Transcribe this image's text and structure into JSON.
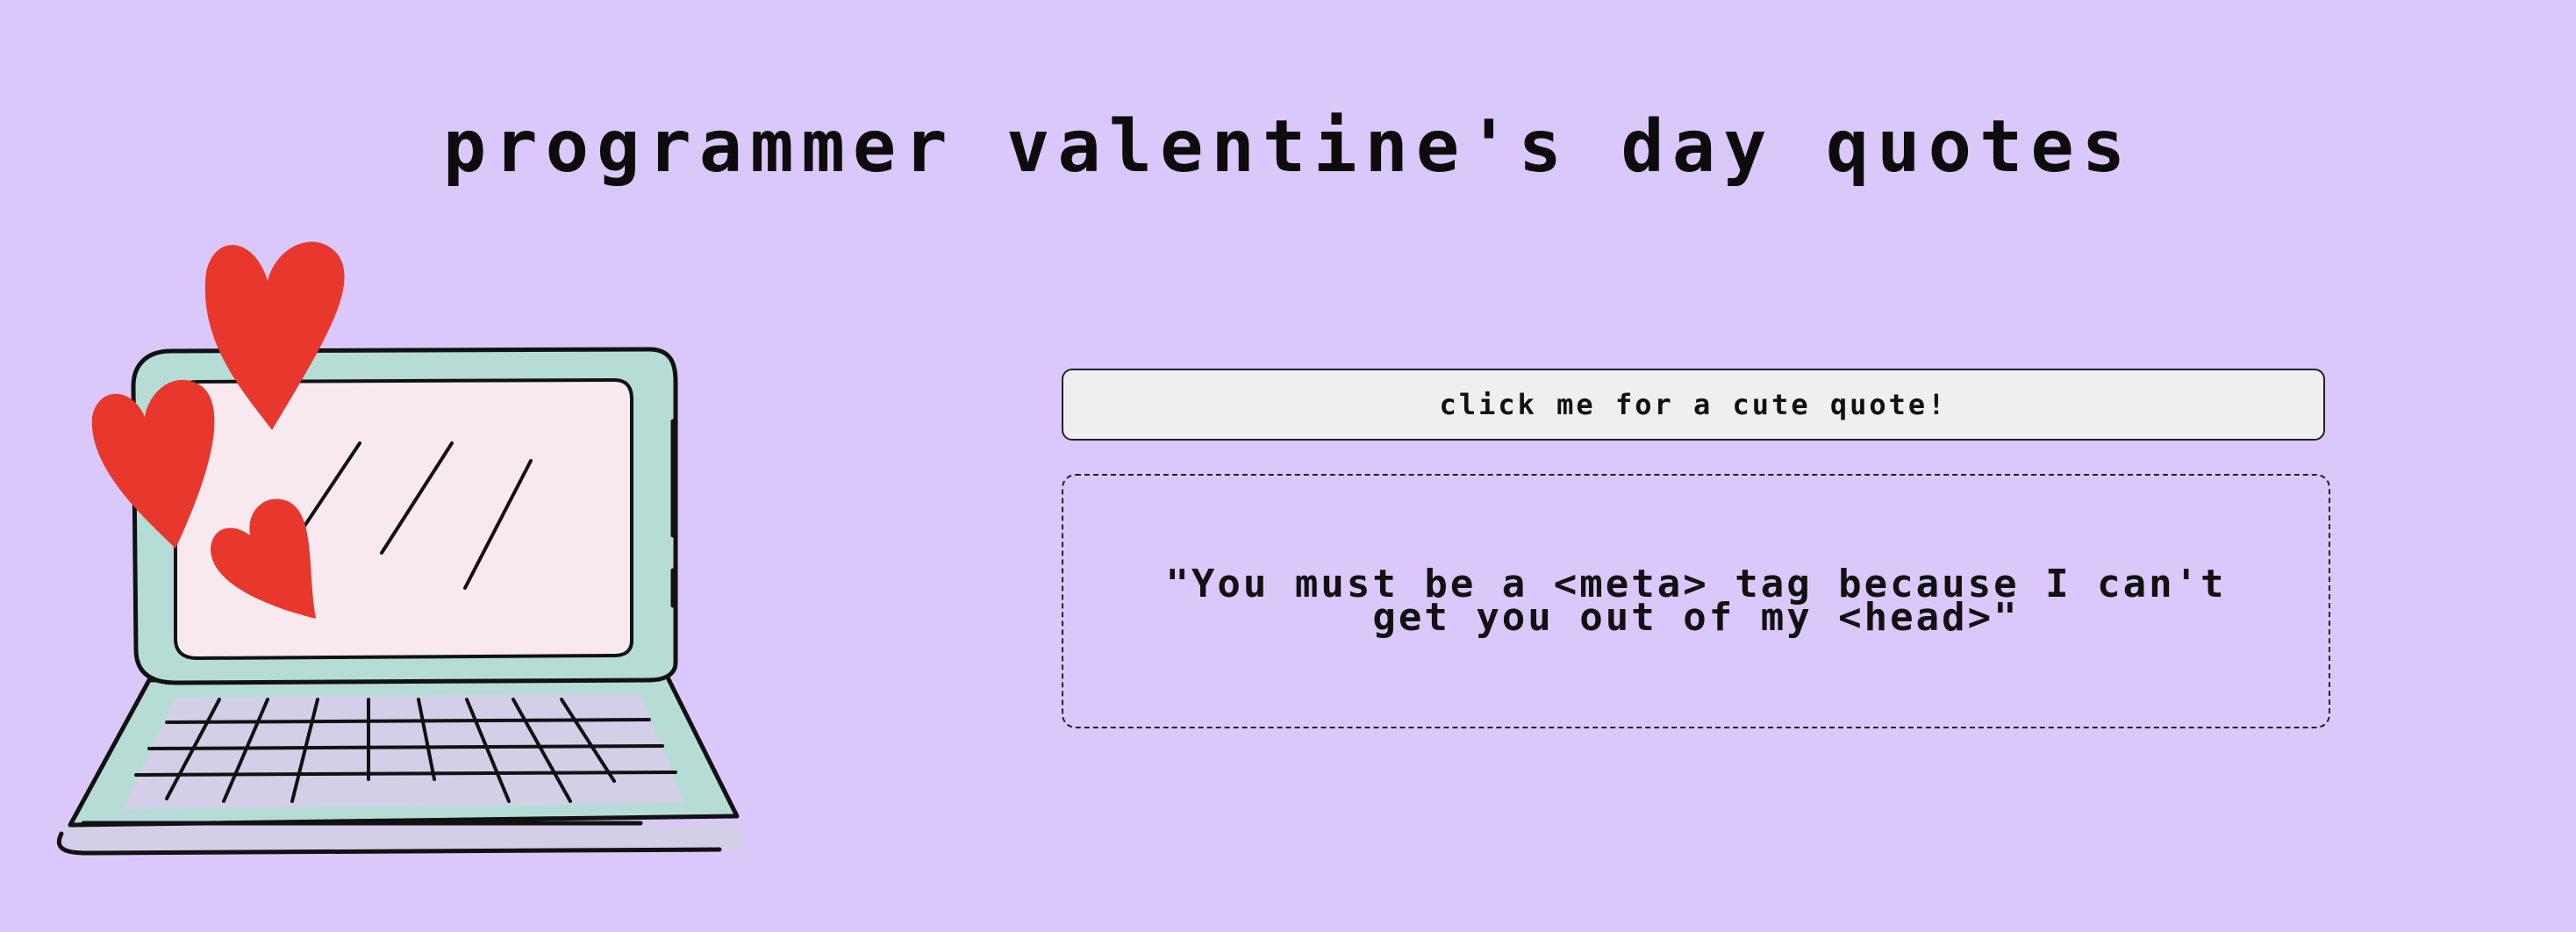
{
  "page": {
    "title": "programmer valentine's day quotes"
  },
  "quote_button": {
    "label": "click me for a cute quote!"
  },
  "quote_display": {
    "text": "\"You must be a <meta> tag because I can't get you out of my <head>\""
  },
  "illustration": {
    "subject": "laptop-with-hearts",
    "colors": {
      "background": "#dac8fb",
      "laptop_body": "#b5ddd6",
      "screen": "#f8e9ef",
      "keyboard": "#d3cfe8",
      "hearts": "#e8372c",
      "outline": "#111111"
    }
  }
}
